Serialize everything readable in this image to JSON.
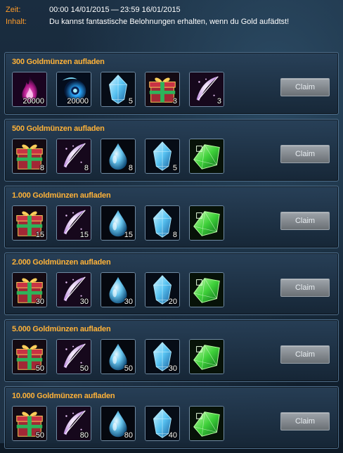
{
  "header": {
    "time_label": "Zeit:",
    "time_value": "00:00 14/01/2015 — 23:59 16/01/2015",
    "content_label": "Inhalt:",
    "content_value": "Du kannst fantastische Belohnungen erhalten, wenn du Gold aufädtst!"
  },
  "tiers": [
    {
      "title": "300 Goldmünzen aufladen",
      "claim_label": "Claim",
      "items": [
        {
          "icon": "pink-flame-icon",
          "count": "20000"
        },
        {
          "icon": "blue-orb-icon",
          "count": "20000"
        },
        {
          "icon": "blue-crystal-icon",
          "count": "5"
        },
        {
          "icon": "gift-box-icon",
          "count": "3"
        },
        {
          "icon": "feather-icon",
          "count": "3"
        }
      ]
    },
    {
      "title": "500 Goldmünzen aufladen",
      "claim_label": "Claim",
      "items": [
        {
          "icon": "gift-box-icon",
          "count": "8"
        },
        {
          "icon": "feather-icon",
          "count": "8"
        },
        {
          "icon": "water-drop-icon",
          "count": "8"
        },
        {
          "icon": "blue-crystal-icon",
          "count": "5"
        },
        {
          "icon": "green-gem-icon",
          "count": ""
        }
      ]
    },
    {
      "title": "1.000 Goldmünzen aufladen",
      "claim_label": "Claim",
      "items": [
        {
          "icon": "gift-box-icon",
          "count": "15"
        },
        {
          "icon": "feather-icon",
          "count": "15"
        },
        {
          "icon": "water-drop-icon",
          "count": "15"
        },
        {
          "icon": "blue-crystal-icon",
          "count": "8"
        },
        {
          "icon": "green-gem-icon",
          "count": ""
        }
      ]
    },
    {
      "title": "2.000 Goldmünzen aufladen",
      "claim_label": "Claim",
      "items": [
        {
          "icon": "gift-box-icon",
          "count": "30"
        },
        {
          "icon": "feather-icon",
          "count": "30"
        },
        {
          "icon": "water-drop-icon",
          "count": "30"
        },
        {
          "icon": "blue-crystal-icon",
          "count": "20"
        },
        {
          "icon": "green-gem-icon",
          "count": ""
        }
      ]
    },
    {
      "title": "5.000 Goldmünzen aufladen",
      "claim_label": "Claim",
      "items": [
        {
          "icon": "gift-box-icon",
          "count": "50"
        },
        {
          "icon": "feather-icon",
          "count": "50"
        },
        {
          "icon": "water-drop-icon",
          "count": "50"
        },
        {
          "icon": "blue-crystal-icon",
          "count": "30"
        },
        {
          "icon": "green-gem-icon",
          "count": ""
        }
      ]
    },
    {
      "title": "10.000 Goldmünzen aufladen",
      "claim_label": "Claim",
      "items": [
        {
          "icon": "gift-box-icon",
          "count": "50"
        },
        {
          "icon": "feather-icon",
          "count": "80"
        },
        {
          "icon": "water-drop-icon",
          "count": "80"
        },
        {
          "icon": "blue-crystal-icon",
          "count": "40"
        },
        {
          "icon": "green-gem-icon",
          "count": ""
        }
      ]
    }
  ]
}
